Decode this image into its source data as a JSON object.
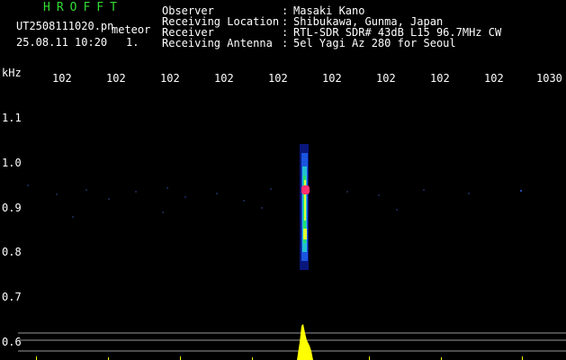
{
  "header": {
    "brand": "HROFFT",
    "filename": "UT2508111020.pn",
    "type": "meteor",
    "datetime": "25.08.11 10:20",
    "count": "1.",
    "fields": [
      {
        "label": "Observer",
        "value": "Masaki Kano"
      },
      {
        "label": "Receiving Location",
        "value": "Shibukawa, Gunma, Japan"
      },
      {
        "label": "Receiver",
        "value": "RTL-SDR SDR# 43dB L15 96.7MHz CW"
      },
      {
        "label": "Receiving Antenna",
        "value": "5el Yagi Az 280 for Seoul"
      }
    ]
  },
  "axes": {
    "unit": "kHz",
    "top_ticks": [
      "102",
      "102",
      "102",
      "102",
      "102",
      "102",
      "102",
      "102",
      "102",
      "1030"
    ],
    "left_ticks": [
      "1.1",
      "1.0",
      "0.9",
      "0.8",
      "0.7",
      "0.6"
    ]
  },
  "colors": {
    "background": "#000000",
    "text": "#ffffff",
    "brand": "#33dd33",
    "spectrum": "#ffff00",
    "grid": "#888888"
  }
}
